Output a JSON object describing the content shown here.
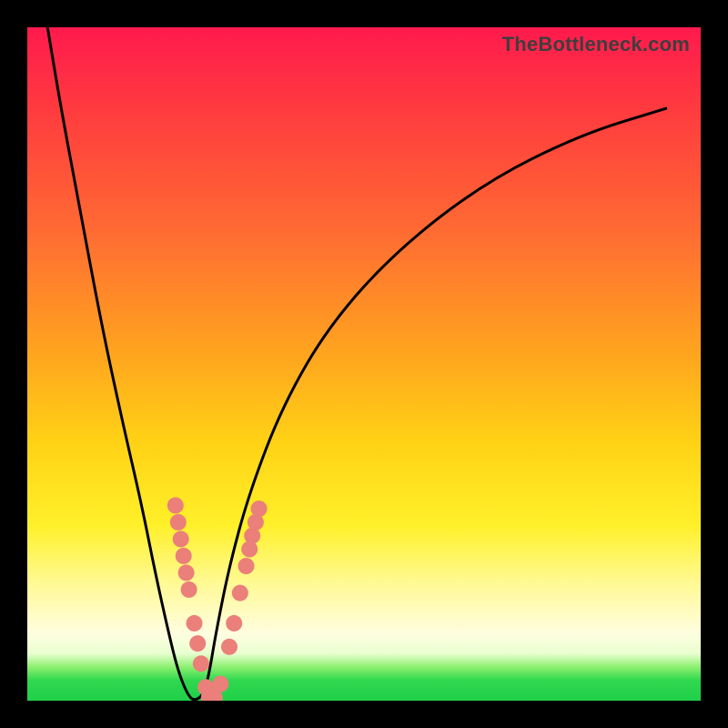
{
  "watermark": "TheBottleneck.com",
  "colors": {
    "dot_fill": "#eb7f7a",
    "curve_stroke": "#000000",
    "gradient_top": "#ff1a4d",
    "gradient_bottom": "#20cf4a"
  },
  "chart_data": {
    "type": "line",
    "title": "",
    "xlabel": "",
    "ylabel": "",
    "xlim": [
      0,
      100
    ],
    "ylim": [
      0,
      100
    ],
    "series": [
      {
        "name": "bottleneck-curve",
        "x": [
          3,
          5,
          8,
          11,
          14,
          17,
          19,
          21,
          22.5,
          24,
          25,
          26.2,
          27,
          28,
          30,
          33,
          38,
          45,
          55,
          68,
          82,
          95
        ],
        "y": [
          100,
          88,
          72,
          56,
          42,
          29,
          19,
          10,
          4,
          0.5,
          0,
          1,
          4,
          10,
          20,
          31,
          44,
          56,
          67,
          77,
          84,
          88
        ]
      }
    ],
    "markers": [
      {
        "x": 22.0,
        "y": 29.0
      },
      {
        "x": 22.4,
        "y": 26.5
      },
      {
        "x": 22.8,
        "y": 24.0
      },
      {
        "x": 23.2,
        "y": 21.5
      },
      {
        "x": 23.6,
        "y": 19.0
      },
      {
        "x": 24.0,
        "y": 16.5
      },
      {
        "x": 24.8,
        "y": 11.5
      },
      {
        "x": 25.3,
        "y": 8.5
      },
      {
        "x": 25.8,
        "y": 5.5
      },
      {
        "x": 26.5,
        "y": 2.0
      },
      {
        "x": 27.0,
        "y": 0.5
      },
      {
        "x": 27.8,
        "y": 0.5
      },
      {
        "x": 28.7,
        "y": 2.5
      },
      {
        "x": 30.0,
        "y": 8.0
      },
      {
        "x": 30.7,
        "y": 11.5
      },
      {
        "x": 31.6,
        "y": 16.0
      },
      {
        "x": 32.5,
        "y": 20.0
      },
      {
        "x": 33.0,
        "y": 22.5
      },
      {
        "x": 33.4,
        "y": 24.5
      },
      {
        "x": 33.9,
        "y": 26.5
      },
      {
        "x": 34.4,
        "y": 28.5
      }
    ]
  }
}
